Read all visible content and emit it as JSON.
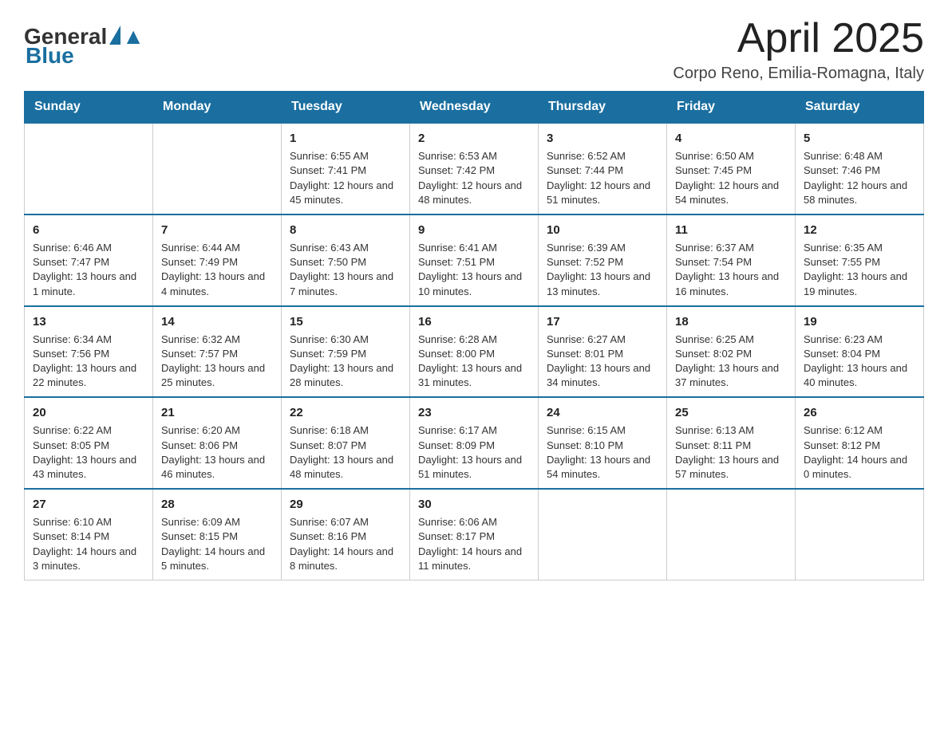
{
  "header": {
    "title": "April 2025",
    "location": "Corpo Reno, Emilia-Romagna, Italy"
  },
  "logo": {
    "general": "General",
    "blue": "Blue"
  },
  "weekdays": [
    "Sunday",
    "Monday",
    "Tuesday",
    "Wednesday",
    "Thursday",
    "Friday",
    "Saturday"
  ],
  "weeks": [
    [
      {
        "day": "",
        "sunrise": "",
        "sunset": "",
        "daylight": ""
      },
      {
        "day": "",
        "sunrise": "",
        "sunset": "",
        "daylight": ""
      },
      {
        "day": "1",
        "sunrise": "Sunrise: 6:55 AM",
        "sunset": "Sunset: 7:41 PM",
        "daylight": "Daylight: 12 hours and 45 minutes."
      },
      {
        "day": "2",
        "sunrise": "Sunrise: 6:53 AM",
        "sunset": "Sunset: 7:42 PM",
        "daylight": "Daylight: 12 hours and 48 minutes."
      },
      {
        "day": "3",
        "sunrise": "Sunrise: 6:52 AM",
        "sunset": "Sunset: 7:44 PM",
        "daylight": "Daylight: 12 hours and 51 minutes."
      },
      {
        "day": "4",
        "sunrise": "Sunrise: 6:50 AM",
        "sunset": "Sunset: 7:45 PM",
        "daylight": "Daylight: 12 hours and 54 minutes."
      },
      {
        "day": "5",
        "sunrise": "Sunrise: 6:48 AM",
        "sunset": "Sunset: 7:46 PM",
        "daylight": "Daylight: 12 hours and 58 minutes."
      }
    ],
    [
      {
        "day": "6",
        "sunrise": "Sunrise: 6:46 AM",
        "sunset": "Sunset: 7:47 PM",
        "daylight": "Daylight: 13 hours and 1 minute."
      },
      {
        "day": "7",
        "sunrise": "Sunrise: 6:44 AM",
        "sunset": "Sunset: 7:49 PM",
        "daylight": "Daylight: 13 hours and 4 minutes."
      },
      {
        "day": "8",
        "sunrise": "Sunrise: 6:43 AM",
        "sunset": "Sunset: 7:50 PM",
        "daylight": "Daylight: 13 hours and 7 minutes."
      },
      {
        "day": "9",
        "sunrise": "Sunrise: 6:41 AM",
        "sunset": "Sunset: 7:51 PM",
        "daylight": "Daylight: 13 hours and 10 minutes."
      },
      {
        "day": "10",
        "sunrise": "Sunrise: 6:39 AM",
        "sunset": "Sunset: 7:52 PM",
        "daylight": "Daylight: 13 hours and 13 minutes."
      },
      {
        "day": "11",
        "sunrise": "Sunrise: 6:37 AM",
        "sunset": "Sunset: 7:54 PM",
        "daylight": "Daylight: 13 hours and 16 minutes."
      },
      {
        "day": "12",
        "sunrise": "Sunrise: 6:35 AM",
        "sunset": "Sunset: 7:55 PM",
        "daylight": "Daylight: 13 hours and 19 minutes."
      }
    ],
    [
      {
        "day": "13",
        "sunrise": "Sunrise: 6:34 AM",
        "sunset": "Sunset: 7:56 PM",
        "daylight": "Daylight: 13 hours and 22 minutes."
      },
      {
        "day": "14",
        "sunrise": "Sunrise: 6:32 AM",
        "sunset": "Sunset: 7:57 PM",
        "daylight": "Daylight: 13 hours and 25 minutes."
      },
      {
        "day": "15",
        "sunrise": "Sunrise: 6:30 AM",
        "sunset": "Sunset: 7:59 PM",
        "daylight": "Daylight: 13 hours and 28 minutes."
      },
      {
        "day": "16",
        "sunrise": "Sunrise: 6:28 AM",
        "sunset": "Sunset: 8:00 PM",
        "daylight": "Daylight: 13 hours and 31 minutes."
      },
      {
        "day": "17",
        "sunrise": "Sunrise: 6:27 AM",
        "sunset": "Sunset: 8:01 PM",
        "daylight": "Daylight: 13 hours and 34 minutes."
      },
      {
        "day": "18",
        "sunrise": "Sunrise: 6:25 AM",
        "sunset": "Sunset: 8:02 PM",
        "daylight": "Daylight: 13 hours and 37 minutes."
      },
      {
        "day": "19",
        "sunrise": "Sunrise: 6:23 AM",
        "sunset": "Sunset: 8:04 PM",
        "daylight": "Daylight: 13 hours and 40 minutes."
      }
    ],
    [
      {
        "day": "20",
        "sunrise": "Sunrise: 6:22 AM",
        "sunset": "Sunset: 8:05 PM",
        "daylight": "Daylight: 13 hours and 43 minutes."
      },
      {
        "day": "21",
        "sunrise": "Sunrise: 6:20 AM",
        "sunset": "Sunset: 8:06 PM",
        "daylight": "Daylight: 13 hours and 46 minutes."
      },
      {
        "day": "22",
        "sunrise": "Sunrise: 6:18 AM",
        "sunset": "Sunset: 8:07 PM",
        "daylight": "Daylight: 13 hours and 48 minutes."
      },
      {
        "day": "23",
        "sunrise": "Sunrise: 6:17 AM",
        "sunset": "Sunset: 8:09 PM",
        "daylight": "Daylight: 13 hours and 51 minutes."
      },
      {
        "day": "24",
        "sunrise": "Sunrise: 6:15 AM",
        "sunset": "Sunset: 8:10 PM",
        "daylight": "Daylight: 13 hours and 54 minutes."
      },
      {
        "day": "25",
        "sunrise": "Sunrise: 6:13 AM",
        "sunset": "Sunset: 8:11 PM",
        "daylight": "Daylight: 13 hours and 57 minutes."
      },
      {
        "day": "26",
        "sunrise": "Sunrise: 6:12 AM",
        "sunset": "Sunset: 8:12 PM",
        "daylight": "Daylight: 14 hours and 0 minutes."
      }
    ],
    [
      {
        "day": "27",
        "sunrise": "Sunrise: 6:10 AM",
        "sunset": "Sunset: 8:14 PM",
        "daylight": "Daylight: 14 hours and 3 minutes."
      },
      {
        "day": "28",
        "sunrise": "Sunrise: 6:09 AM",
        "sunset": "Sunset: 8:15 PM",
        "daylight": "Daylight: 14 hours and 5 minutes."
      },
      {
        "day": "29",
        "sunrise": "Sunrise: 6:07 AM",
        "sunset": "Sunset: 8:16 PM",
        "daylight": "Daylight: 14 hours and 8 minutes."
      },
      {
        "day": "30",
        "sunrise": "Sunrise: 6:06 AM",
        "sunset": "Sunset: 8:17 PM",
        "daylight": "Daylight: 14 hours and 11 minutes."
      },
      {
        "day": "",
        "sunrise": "",
        "sunset": "",
        "daylight": ""
      },
      {
        "day": "",
        "sunrise": "",
        "sunset": "",
        "daylight": ""
      },
      {
        "day": "",
        "sunrise": "",
        "sunset": "",
        "daylight": ""
      }
    ]
  ]
}
